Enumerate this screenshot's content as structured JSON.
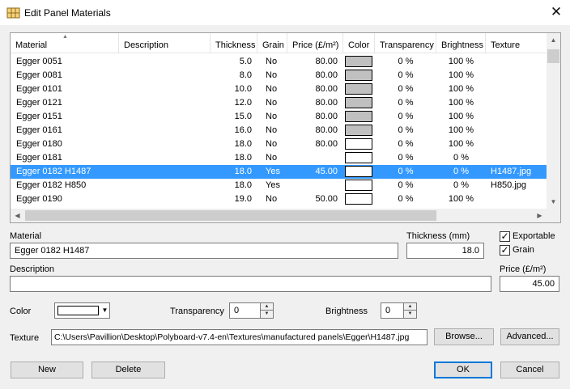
{
  "window": {
    "title": "Edit Panel Materials",
    "close_glyph": "✕"
  },
  "table": {
    "columns": [
      "Material",
      "Description",
      "Thickness",
      "Grain",
      "Price (£/m²)",
      "Color",
      "Transparency",
      "Brightness",
      "Texture"
    ],
    "rows": [
      {
        "material": "Egger 0051",
        "description": "",
        "thickness": "5.0",
        "grain": "No",
        "price": "80.00",
        "color": "#c0c0c0",
        "transparency": "0 %",
        "brightness": "100 %",
        "texture": "",
        "selected": false
      },
      {
        "material": "Egger 0081",
        "description": "",
        "thickness": "8.0",
        "grain": "No",
        "price": "80.00",
        "color": "#c0c0c0",
        "transparency": "0 %",
        "brightness": "100 %",
        "texture": "",
        "selected": false
      },
      {
        "material": "Egger 0101",
        "description": "",
        "thickness": "10.0",
        "grain": "No",
        "price": "80.00",
        "color": "#c0c0c0",
        "transparency": "0 %",
        "brightness": "100 %",
        "texture": "",
        "selected": false
      },
      {
        "material": "Egger 0121",
        "description": "",
        "thickness": "12.0",
        "grain": "No",
        "price": "80.00",
        "color": "#c0c0c0",
        "transparency": "0 %",
        "brightness": "100 %",
        "texture": "",
        "selected": false
      },
      {
        "material": "Egger 0151",
        "description": "",
        "thickness": "15.0",
        "grain": "No",
        "price": "80.00",
        "color": "#c0c0c0",
        "transparency": "0 %",
        "brightness": "100 %",
        "texture": "",
        "selected": false
      },
      {
        "material": "Egger 0161",
        "description": "",
        "thickness": "16.0",
        "grain": "No",
        "price": "80.00",
        "color": "#c0c0c0",
        "transparency": "0 %",
        "brightness": "100 %",
        "texture": "",
        "selected": false
      },
      {
        "material": "Egger 0180",
        "description": "",
        "thickness": "18.0",
        "grain": "No",
        "price": "80.00",
        "color": "#ffffff",
        "transparency": "0 %",
        "brightness": "100 %",
        "texture": "",
        "selected": false
      },
      {
        "material": "Egger 0181",
        "description": "",
        "thickness": "18.0",
        "grain": "No",
        "price": "",
        "color": "#ffffff",
        "transparency": "0 %",
        "brightness": "0 %",
        "texture": "",
        "selected": false
      },
      {
        "material": "Egger 0182 H1487",
        "description": "",
        "thickness": "18.0",
        "grain": "Yes",
        "price": "45.00",
        "color": "#ffffff",
        "transparency": "0 %",
        "brightness": "0 %",
        "texture": "H1487.jpg",
        "selected": true
      },
      {
        "material": "Egger 0182 H850",
        "description": "",
        "thickness": "18.0",
        "grain": "Yes",
        "price": "",
        "color": "#ffffff",
        "transparency": "0 %",
        "brightness": "0 %",
        "texture": "H850.jpg",
        "selected": false
      },
      {
        "material": "Egger 0190",
        "description": "",
        "thickness": "19.0",
        "grain": "No",
        "price": "50.00",
        "color": "#ffffff",
        "transparency": "0 %",
        "brightness": "100 %",
        "texture": "",
        "selected": false
      }
    ],
    "scroll_icons": {
      "up": "▲",
      "down": "▼",
      "left": "◀",
      "right": "▶",
      "sort": "▲"
    }
  },
  "form": {
    "material_label": "Material",
    "material_value": "Egger 0182 H1487",
    "thickness_label": "Thickness (mm)",
    "thickness_value": "18.0",
    "exportable_label": "Exportable",
    "exportable_checked": true,
    "grain_label": "Grain",
    "grain_checked": true,
    "check_glyph": "✓",
    "description_label": "Description",
    "description_value": "",
    "price_label": "Price (£/m²)",
    "price_value": "45.00",
    "color_label": "Color",
    "color_value": "#ffffff",
    "color_arrow": "▼",
    "transparency_label": "Transparency",
    "transparency_value": "0",
    "brightness_label": "Brightness",
    "brightness_value": "0",
    "spin_up": "▲",
    "spin_down": "▼",
    "texture_label": "Texture",
    "texture_value": "C:\\Users\\Pavillion\\Desktop\\Polyboard-v7.4-en\\Textures\\manufactured panels\\Egger\\H1487.jpg",
    "browse_label": "Browse...",
    "advanced_label": "Advanced..."
  },
  "buttons": {
    "new": "New",
    "delete": "Delete",
    "ok": "OK",
    "cancel": "Cancel"
  },
  "colors": {
    "selection": "#3399ff",
    "default_button_border": "#0078d7"
  }
}
